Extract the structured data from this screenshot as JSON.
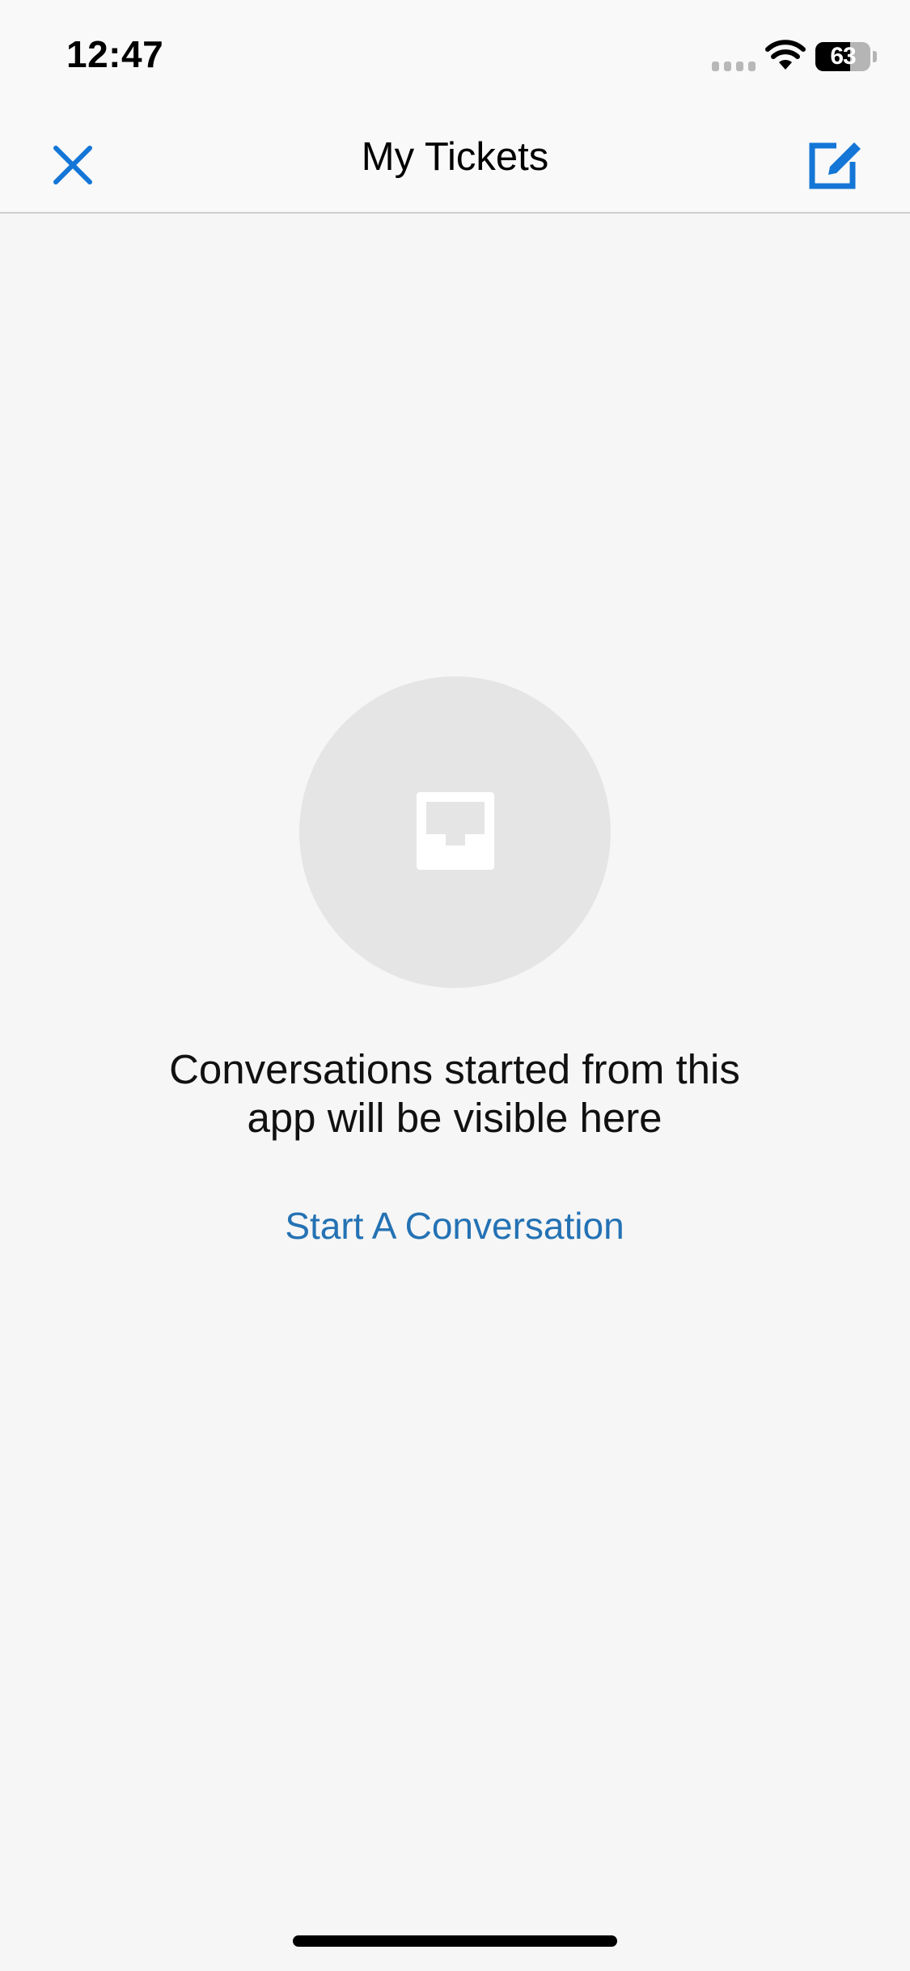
{
  "status_bar": {
    "time": "12:47",
    "battery_level": "63",
    "icons": [
      "cellular-signal-icon",
      "wifi-icon",
      "battery-icon"
    ]
  },
  "nav_bar": {
    "title": "My Tickets",
    "left_icon": "close-icon",
    "right_icon": "compose-icon"
  },
  "empty_state": {
    "icon": "inbox-icon",
    "message": "Conversations started from this app will be visible here",
    "action_label": "Start A Conversation"
  },
  "colors": {
    "accent": "#1476d6",
    "link": "#2472b4",
    "background": "#f6f6f6",
    "circle": "#e5e5e5"
  }
}
